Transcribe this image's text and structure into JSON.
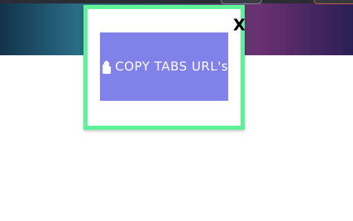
{
  "colors": {
    "popup_border": "#5ff19a",
    "button_bg": "#8181ea",
    "button_text": "#ffffff",
    "close_text": "#000000"
  },
  "popup": {
    "close_label": "X",
    "copy_button": {
      "label": "COPY TABS URL's",
      "icon": "copy-icon"
    }
  }
}
